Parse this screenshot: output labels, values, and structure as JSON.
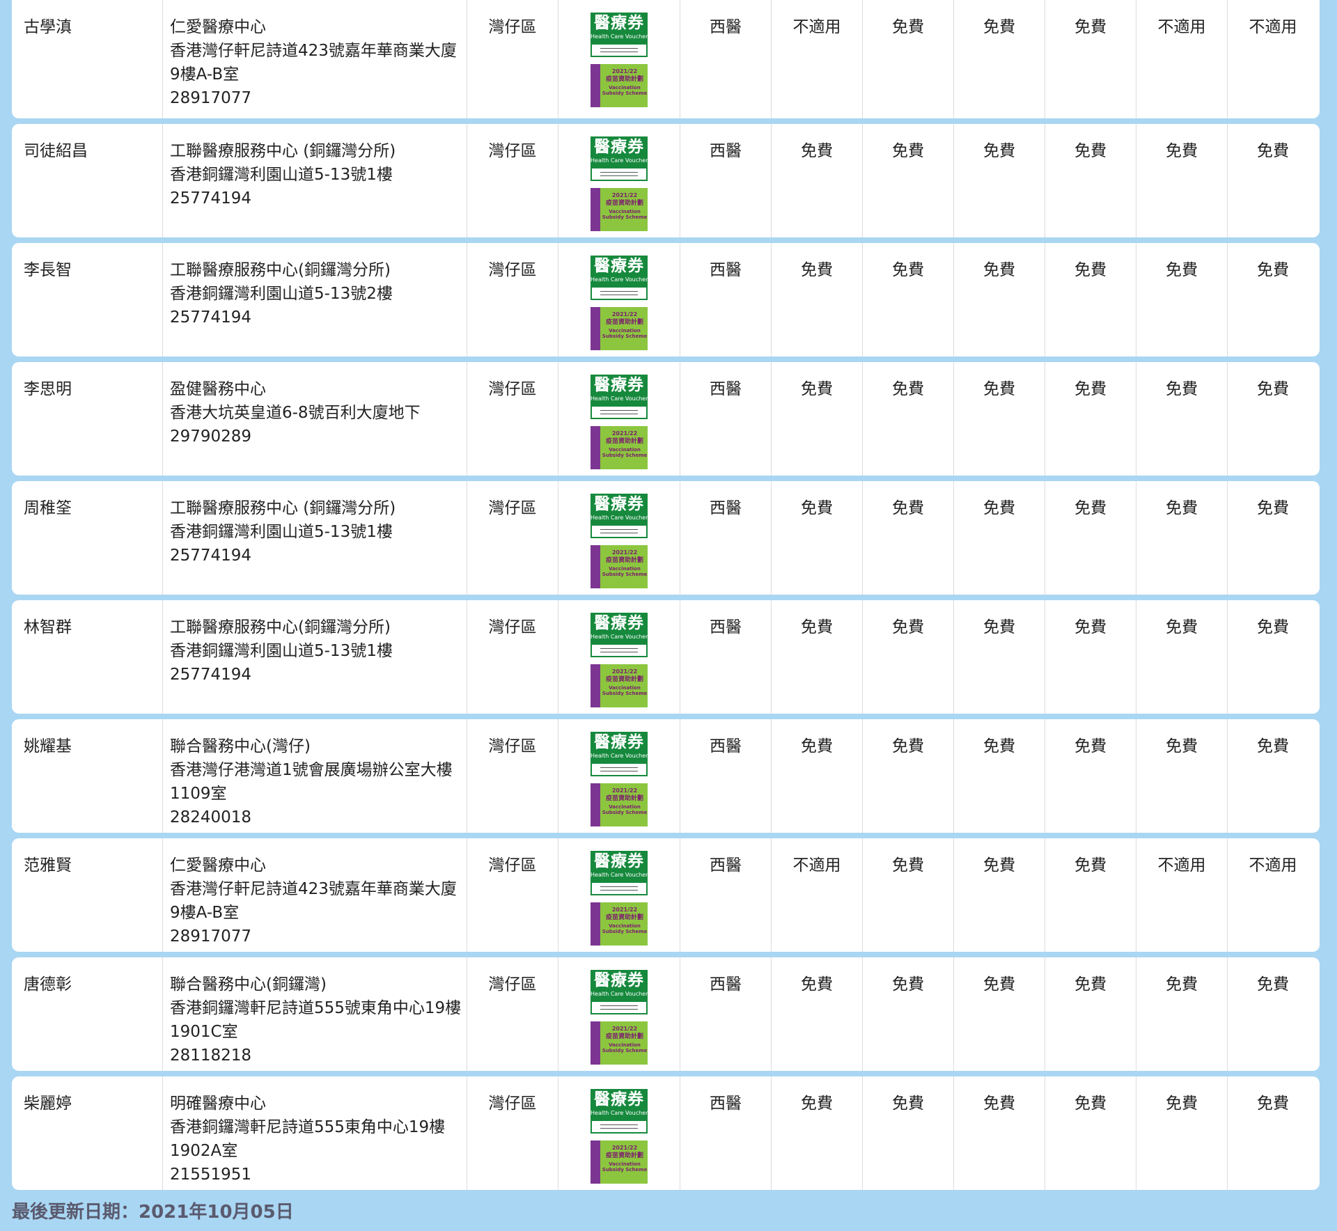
{
  "doctors": [
    {
      "name": "古學滇",
      "clinic": "仁愛醫療中心",
      "address": "香港灣仔軒尼詩道423號嘉年華商業大廈9樓A-B室",
      "phone": "28917077",
      "district": "灣仔區",
      "type": "西醫",
      "fees": [
        "不適用",
        "免費",
        "免費",
        "免費",
        "不適用",
        "不適用"
      ]
    },
    {
      "name": "司徒紹昌",
      "clinic": "工聯醫療服務中心 (銅鑼灣分所)",
      "address": "香港銅鑼灣利園山道5-13號1樓",
      "phone": "25774194",
      "district": "灣仔區",
      "type": "西醫",
      "fees": [
        "免費",
        "免費",
        "免費",
        "免費",
        "免費",
        "免費"
      ]
    },
    {
      "name": "李長智",
      "clinic": "工聯醫療服務中心(銅鑼灣分所)",
      "address": "香港銅鑼灣利園山道5-13號2樓",
      "phone": "25774194",
      "district": "灣仔區",
      "type": "西醫",
      "fees": [
        "免費",
        "免費",
        "免費",
        "免費",
        "免費",
        "免費"
      ]
    },
    {
      "name": "李思明",
      "clinic": "盈健醫務中心",
      "address": "香港大坑英皇道6-8號百利大廈地下",
      "phone": "29790289",
      "district": "灣仔區",
      "type": "西醫",
      "fees": [
        "免費",
        "免費",
        "免費",
        "免費",
        "免費",
        "免費"
      ]
    },
    {
      "name": "周稚筌",
      "clinic": "工聯醫療服務中心 (銅鑼灣分所)",
      "address": "香港銅鑼灣利園山道5-13號1樓",
      "phone": "25774194",
      "district": "灣仔區",
      "type": "西醫",
      "fees": [
        "免費",
        "免費",
        "免費",
        "免費",
        "免費",
        "免費"
      ]
    },
    {
      "name": "林智群",
      "clinic": "工聯醫療服務中心(銅鑼灣分所)",
      "address": "香港銅鑼灣利園山道5-13號1樓",
      "phone": "25774194",
      "district": "灣仔區",
      "type": "西醫",
      "fees": [
        "免費",
        "免費",
        "免費",
        "免費",
        "免費",
        "免費"
      ]
    },
    {
      "name": "姚耀基",
      "clinic": "聯合醫務中心(灣仔)",
      "address": "香港灣仔港灣道1號會展廣場辦公室大樓1109室",
      "phone": "28240018",
      "district": "灣仔區",
      "type": "西醫",
      "fees": [
        "免費",
        "免費",
        "免費",
        "免費",
        "免費",
        "免費"
      ]
    },
    {
      "name": "范雅賢",
      "clinic": "仁愛醫療中心",
      "address": "香港灣仔軒尼詩道423號嘉年華商業大廈9樓A-B室",
      "phone": "28917077",
      "district": "灣仔區",
      "type": "西醫",
      "fees": [
        "不適用",
        "免費",
        "免費",
        "免費",
        "不適用",
        "不適用"
      ]
    },
    {
      "name": "唐德彰",
      "clinic": "聯合醫務中心(銅鑼灣)",
      "address": "香港銅鑼灣軒尼詩道555號東角中心19樓1901C室",
      "phone": "28118218",
      "district": "灣仔區",
      "type": "西醫",
      "fees": [
        "免費",
        "免費",
        "免費",
        "免費",
        "免費",
        "免費"
      ]
    },
    {
      "name": "柴麗婷",
      "clinic": "明確醫療中心",
      "address": "香港銅鑼灣軒尼詩道555東角中心19樓1902A室",
      "phone": "21551951",
      "district": "灣仔區",
      "type": "西醫",
      "fees": [
        "免費",
        "免費",
        "免費",
        "免費",
        "免費",
        "免費"
      ]
    }
  ],
  "badges": {
    "voucher_title": "醫療券",
    "voucher_subtitle": "Health Care Voucher",
    "vaccine_year": "2021/22",
    "vaccine_title": "疫苗資助計劃",
    "vaccine_en": "Vaccination Subsidy Scheme"
  },
  "footer": {
    "last_updated": "最後更新日期：2021年10月05日"
  },
  "colors": {
    "page_background": "#a9d6f3",
    "voucher_green": "#16893d",
    "vaccine_green": "#8cc63f",
    "vaccine_purple": "#7c3592"
  }
}
